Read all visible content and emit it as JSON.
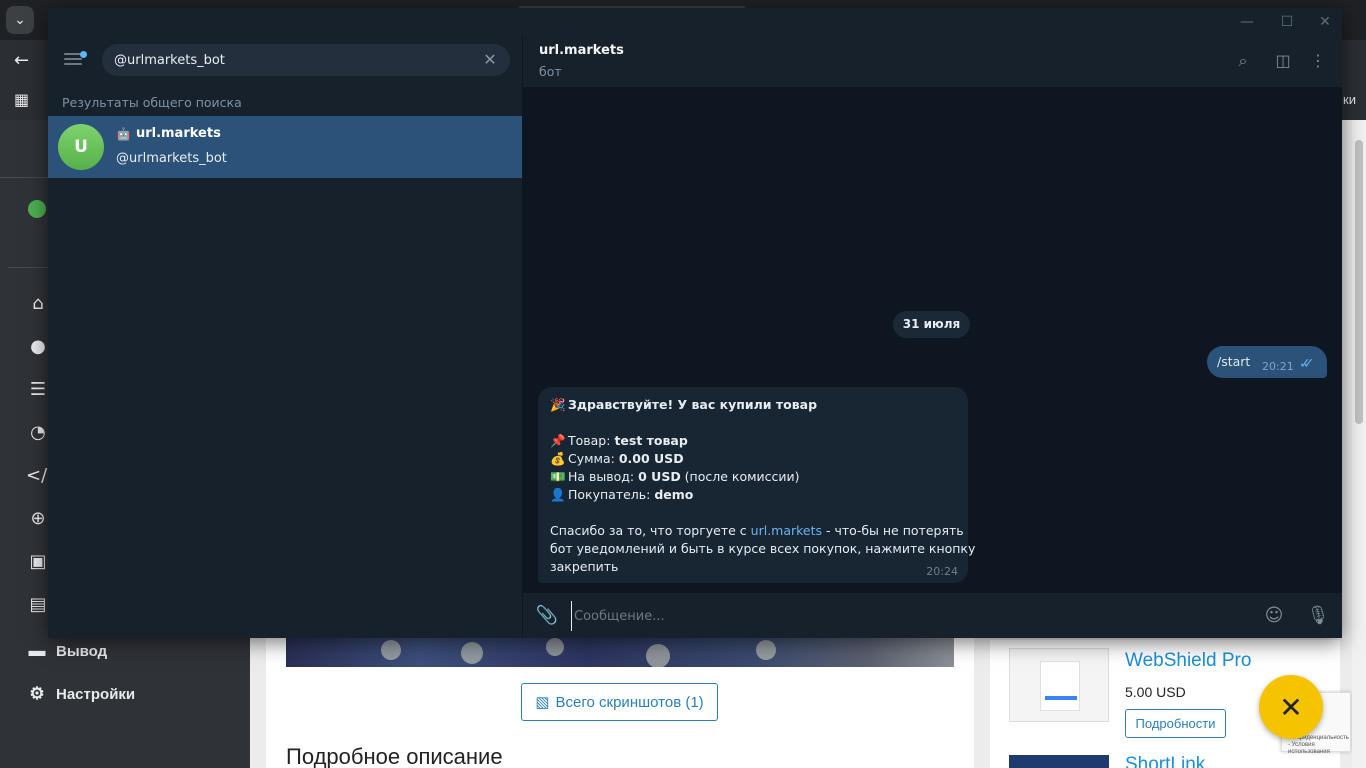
{
  "browser": {
    "right_text": "ки",
    "sidebar": {
      "withdraw_label": "Вывод",
      "settings_label": "Настройки"
    },
    "page": {
      "screenshots_button": "Всего скриншотов (1)",
      "description_heading": "Подробное описание",
      "products": [
        {
          "title": "WebShield Pro",
          "price": "5.00 USD",
          "button": "Подробности"
        },
        {
          "title": "ShortLink"
        }
      ],
      "recaptcha_text": "Конфиденциальность - Условия использования"
    }
  },
  "telegram": {
    "search": {
      "value": "@urlmarkets_bot"
    },
    "results_section_label": "Результаты общего поиска",
    "result": {
      "avatar_letter": "U",
      "name": "url.markets",
      "username": "@urlmarkets_bot"
    },
    "chat": {
      "title": "url.markets",
      "subtitle": "бот",
      "date": "31 июля",
      "outgoing": {
        "text": "/start",
        "time": "20:21"
      },
      "incoming": {
        "greeting": "Здравствуйте! У вас купили товар",
        "product_label": "Товар: ",
        "product_value": "test товар",
        "sum_label": "Сумма: ",
        "sum_value": "0.00 USD",
        "payout_label": "На вывод: ",
        "payout_value": "0 USD",
        "payout_note": " (после комиссии)",
        "buyer_label": "Покупатель: ",
        "buyer_value": "demo",
        "thanks_prefix": "Спасибо за то, что торгуете с ",
        "thanks_link": "url.markets",
        "thanks_suffix_1": " - что-бы не потерять",
        "thanks_line2": "бот уведомлений и быть в курсе всех покупок, нажмите кнопку",
        "thanks_line3": "закрепить",
        "time": "20:24"
      }
    },
    "composer": {
      "placeholder": "Сообщение..."
    }
  },
  "colors": {
    "accent": "#5eb5f7",
    "selected_row": "#2b5278",
    "chat_bg": "#0e1621",
    "panel_bg": "#17212b",
    "link": "#6ab3f3",
    "fab": "#f5c400"
  }
}
